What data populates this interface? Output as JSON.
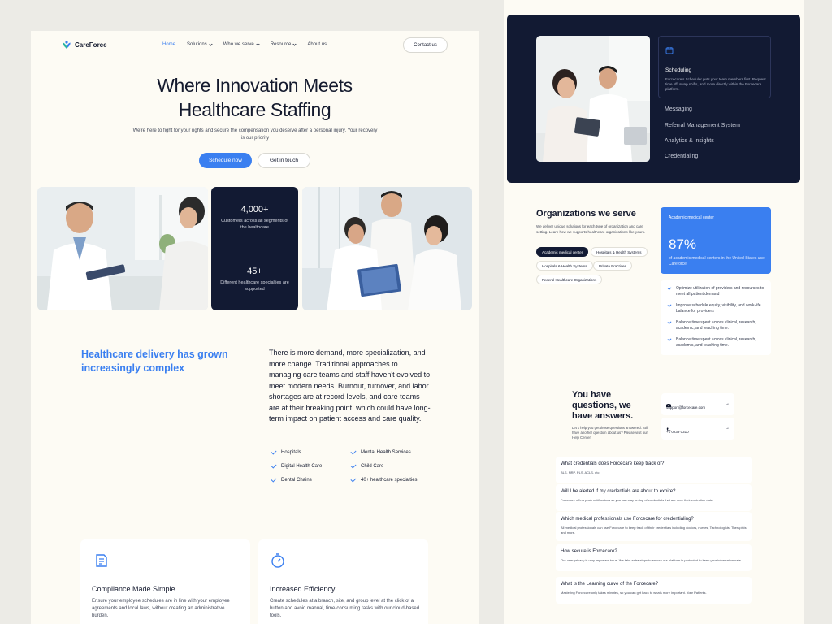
{
  "brand": {
    "name": "CareForce"
  },
  "nav": {
    "items": [
      {
        "label": "Home",
        "dropdown": false,
        "active": true
      },
      {
        "label": "Solutions",
        "dropdown": true,
        "active": false
      },
      {
        "label": "Who we serve",
        "dropdown": true,
        "active": false
      },
      {
        "label": "Resource",
        "dropdown": true,
        "active": false
      },
      {
        "label": "About us",
        "dropdown": false,
        "active": false
      }
    ],
    "contact_label": "Contact us"
  },
  "hero": {
    "title_line1": "Where Innovation Meets",
    "title_line2": "Healthcare Staffing",
    "subtitle": "We're here to fight for your rights and secure the compensation you deserve after a personal injury.  Your recovery is our priority",
    "primary_label": "Schedule now",
    "secondary_label": "Get in touch"
  },
  "stats": [
    {
      "value": "4,000+",
      "label": "Customers across all segments of the healthcare"
    },
    {
      "value": "45+",
      "label": "Different healthcare specialties are supported"
    }
  ],
  "complexity": {
    "title": "Healthcare delivery has grown increasingly complex",
    "body": "There is more demand, more specialization, and more change. Traditional approaches to managing care teams and staff haven't evolved to meet modern needs. Burnout, turnover, and labor shortages are at record levels, and care teams are at their breaking point, which could have long-term impact on patient access and care quality.",
    "checklist": [
      "Hospitals",
      "Mental Health Services",
      "Digital Health Care",
      "Child Care",
      "Dental Chains",
      "40+ healthcare specialties"
    ]
  },
  "features": [
    {
      "title": "Compliance Made Simple",
      "text": "Ensure your employee schedules are in line with your employee agreements and local laws, without creating an administrative burden.",
      "icon": "document-icon"
    },
    {
      "title": "Increased Efficiency",
      "text": "Create schedules at a branch, site, and group level at the click of a button and avoid manual, time-consuming tasks with our cloud-based tools.",
      "icon": "stopwatch-icon"
    }
  ],
  "solutions": {
    "active_title": "Scheduling",
    "active_text": "Forcecare's Scheduler puts your team members first. Request time off, swap shifts, and more directly within the Forcecare platform.",
    "menu": [
      "Messaging",
      "Referral Management System",
      "Analytics & Insights",
      "Credentialing"
    ]
  },
  "organizations": {
    "title": "Organizations we serve",
    "subtitle": "We deliver unique solutions for each type of organization and care setting. Learn how we supports healthcare organizations like yours.",
    "chips": [
      "Academic medical center",
      "Hospitals & Health Systems",
      "Hospitals & Health Systems",
      "Private Practices",
      "Federal Healthcare Organizations"
    ],
    "highlight": {
      "label": "Academic medical center",
      "value": "87%",
      "text": "of academic medical centers in the United States use Careforce."
    },
    "benefits": [
      "Optimize utilization of providers and resources to meet all patient demand",
      "Improve schedule equity, visibility, and work-life balance for providers",
      "Balance time spent across clinical, research, academic, and teaching time.",
      "Balance time spent across clinical, research, academic, and teaching time."
    ]
  },
  "questions": {
    "title": "You have questions, we have answers.",
    "subtitle": "Let's help you get those questions answered. Still have another question about us? Please visit our Help Center.",
    "email": "support@forcecare.com",
    "phone": "+1 0239 0310"
  },
  "faqs": [
    {
      "q": "What credentials does Forcecare keep track of?",
      "a": "BLS, NRP, PLS, ACLS, etc"
    },
    {
      "q": "Will I be alerted if my credentials are about to expire?",
      "a": "Forcecare offers push notifications so you can stay on top of credentials that are near their expiration date."
    },
    {
      "q": "Which medical professionals use Forcecare for credentialing?",
      "a": "All medical professionals can use Forcecare to keep track of their credentials including doctors, nurses, Technologists, Therapists, and more."
    },
    {
      "q": "How secure is Forcecare?",
      "a": "Our user privacy is very important to us. We take extra steps to ensure our platform is protected to keep your information safe."
    },
    {
      "q": "What is the Learning curve of the Forcecare?",
      "a": "Mastering Forcecare only takes minutes, so you can get back to whats more important. Your Patients."
    }
  ]
}
